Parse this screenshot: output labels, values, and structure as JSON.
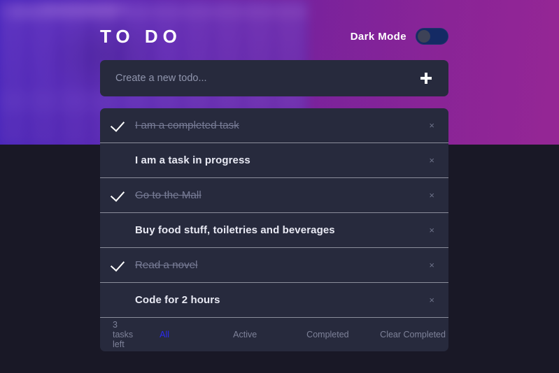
{
  "header": {
    "title": "TO DO",
    "dark_mode_label": "Dark Mode",
    "dark_mode_on": false,
    "toggle_icon": "toggle-switch-icon"
  },
  "new_todo": {
    "value": "",
    "placeholder": "Create a new todo...",
    "add_icon": "plus-icon"
  },
  "todos": [
    {
      "text": "I am a completed task",
      "completed": true,
      "check_icon": "check-icon",
      "delete_icon": "close-icon",
      "delete_label": "×"
    },
    {
      "text": "I am a task in progress",
      "completed": false,
      "check_icon": "check-icon",
      "delete_icon": "close-icon",
      "delete_label": "×"
    },
    {
      "text": "Go to the Mall",
      "completed": true,
      "check_icon": "check-icon",
      "delete_icon": "close-icon",
      "delete_label": "×"
    },
    {
      "text": "Buy food stuff, toiletries and beverages",
      "completed": false,
      "check_icon": "check-icon",
      "delete_icon": "close-icon",
      "delete_label": "×"
    },
    {
      "text": "Read a novel",
      "completed": true,
      "check_icon": "check-icon",
      "delete_icon": "close-icon",
      "delete_label": "×"
    },
    {
      "text": "Code for 2 hours",
      "completed": false,
      "check_icon": "check-icon",
      "delete_icon": "close-icon",
      "delete_label": "×"
    }
  ],
  "footer": {
    "tasks_left": "3 tasks left",
    "filters": [
      {
        "label": "All",
        "active": true
      },
      {
        "label": "Active",
        "active": false
      },
      {
        "label": "Completed",
        "active": false
      }
    ],
    "clear_completed": "Clear Completed"
  },
  "colors": {
    "card_background": "#272a3d",
    "page_background": "#191826",
    "active_filter": "#2b2bf0",
    "muted_text": "#7e8299",
    "primary_text": "#e8e9f3",
    "toggle_track": "#142a64",
    "toggle_knob": "#3d4257"
  }
}
